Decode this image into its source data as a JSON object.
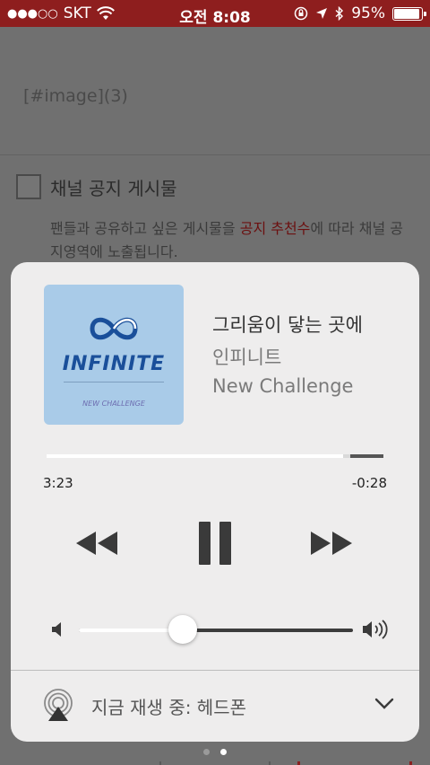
{
  "status_bar": {
    "signal_dots": "●●●○○",
    "carrier": "SKT",
    "time": "오전 8:08",
    "battery_percent": "95%",
    "battery_level": 0.95
  },
  "background_page": {
    "image_tag": "[#image](3)",
    "checkbox_label": "채널 공지 게시물",
    "description_prefix": "팬들과 공유하고 싶은 게시물을 ",
    "description_emphasis": "공지 추천수",
    "description_suffix": "에 따라 채널 공지영역에 노출됩니다."
  },
  "now_playing": {
    "album_art": {
      "logo_text": "INFINITE",
      "subtitle_text": "NEW CHALLENGE"
    },
    "song_title": "그리움이 닿는 곳에",
    "artist": "인피니트",
    "album": "New Challenge",
    "elapsed": "3:23",
    "remaining": "-0:28",
    "progress": 0.88,
    "volume": 0.38,
    "output_label": "지금 재생 중: 헤드폰"
  },
  "icons": {
    "rewind": "rewind-icon",
    "pause": "pause-icon",
    "fast_forward": "fast-forward-icon",
    "volume_low": "speaker-low-icon",
    "volume_high": "speaker-high-icon",
    "airplay": "airplay-icon",
    "chevron": "chevron-down-icon"
  },
  "colors": {
    "status_bar_bg": "#8e1e1e",
    "sheet_bg": "#eeeded",
    "album_art_bg": "#a9cbe8",
    "accent_red": "#8e1e1e"
  },
  "page_dots": {
    "count": 2,
    "active_index": 1
  }
}
